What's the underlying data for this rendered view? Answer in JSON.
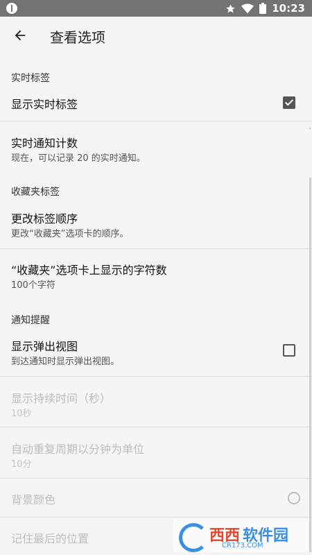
{
  "status_bar": {
    "time": "10:23",
    "icons": [
      "info-icon",
      "star-icon",
      "wifi-icon",
      "battery-icon"
    ]
  },
  "app_bar": {
    "title": "查看选项",
    "back_icon": "arrow-back-icon"
  },
  "sections": {
    "realtime_tags": "实时标签",
    "favorites_tags": "收藏夹标签",
    "notification_alerts": "通知提醒"
  },
  "items": {
    "show_realtime_tags": {
      "title": "显示实时标签",
      "checked": true
    },
    "realtime_notify_count": {
      "title": "实时通知计数",
      "subtitle": "现在，可以记录 20 的实时通知。"
    },
    "change_tag_order": {
      "title": "更改标签顺序",
      "subtitle": "更改“收藏夹”选项卡的顺序。"
    },
    "favorites_tab_chars": {
      "title": "“收藏夹”选项卡上显示的字符数",
      "subtitle": "100个字符"
    },
    "show_popup_view": {
      "title": "显示弹出视图",
      "subtitle": "到达通知时显示弹出视图。",
      "checked": false
    },
    "display_duration": {
      "title": "显示持续时间（秒）",
      "subtitle": "10秒",
      "disabled": true
    },
    "auto_repeat_period": {
      "title": "自动重复周期以分钟为单位",
      "subtitle": "10分",
      "disabled": true
    },
    "background_color": {
      "title": "背景颜色",
      "disabled": true
    },
    "remember_last_position": {
      "title": "记住最后的位置",
      "disabled": true
    }
  },
  "watermark": {
    "brand_cn_1": "西西",
    "brand_cn_2": "软件园",
    "brand_url": "CR173.COM"
  },
  "colors": {
    "status_bar": "#737373",
    "background": "#f5f5f5",
    "disabled_text": "#bdbdbd"
  }
}
